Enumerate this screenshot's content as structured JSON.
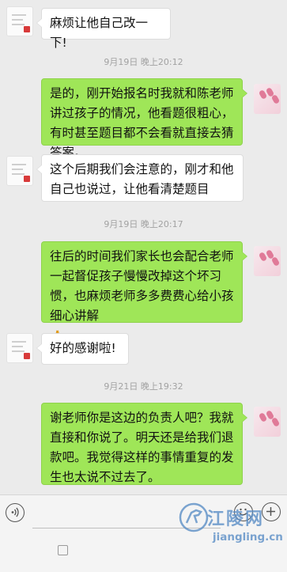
{
  "messages": [
    {
      "side": "left",
      "text": "麻烦让他自己改一下!"
    },
    {
      "side": "right",
      "text": "是的，刚开始报名时我就和陈老师讲过孩子的情况，他看题很粗心，有时甚至题目都不会看就直接去猜答案。"
    },
    {
      "side": "left",
      "text": "这个后期我们会注意的，刚才和他自己也说过，让他看清楚题目"
    },
    {
      "side": "right",
      "text": "往后的时间我们家长也会配合老师一起督促孩子慢慢改掉这个坏习惯，也麻烦老师多多费费心给小孩细心讲解",
      "emoji": "🙏"
    },
    {
      "side": "left",
      "text": "好的感谢啦!"
    },
    {
      "side": "right",
      "text": "谢老师你是这边的负责人吧？我就直接和你说了。明天还是给我们退款吧。我觉得这样的事情重复的发生也太说不过去了。"
    }
  ],
  "timestamps": [
    "9月19日 晚上20:12",
    "9月19日 晚上20:17",
    "9月21日 晚上19:32"
  ],
  "input_bar": {
    "voice_icon": "voice-icon",
    "emoji_icon": "emoji-icon",
    "plus_icon": "plus-icon"
  },
  "watermark": {
    "title": "江陵网",
    "url": "jiangling.cn"
  },
  "colors": {
    "sent_bubble": "#9fe658",
    "received_bubble": "#ffffff",
    "background": "#ebebeb"
  }
}
